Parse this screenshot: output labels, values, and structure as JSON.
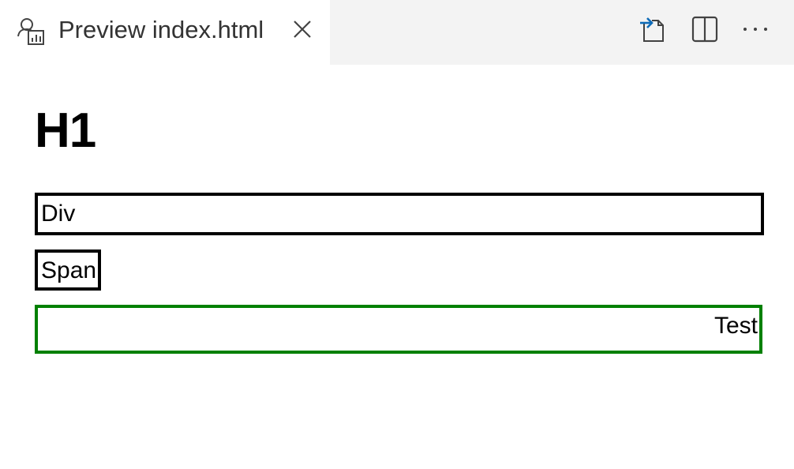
{
  "tab": {
    "label": "Preview index.html",
    "icon": "preview-icon",
    "close_icon": "close-icon"
  },
  "actions": [
    {
      "icon": "open-source-icon"
    },
    {
      "icon": "split-editor-icon"
    },
    {
      "icon": "more-actions-icon"
    }
  ],
  "colors": {
    "tabbar_bg": "#f3f3f3",
    "accent_blue": "#0e6bb8",
    "green_border": "#008000"
  },
  "preview": {
    "h1": "H1",
    "div_text": "Div",
    "span_text": "Span",
    "test_text": "Test"
  }
}
